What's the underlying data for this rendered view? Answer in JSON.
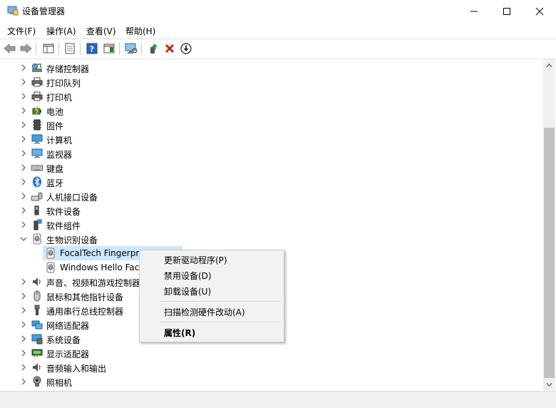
{
  "window": {
    "title": "设备管理器"
  },
  "menu": [
    {
      "id": "file",
      "label": "文件(F)"
    },
    {
      "id": "action",
      "label": "操作(A)"
    },
    {
      "id": "view",
      "label": "查看(V)"
    },
    {
      "id": "help",
      "label": "帮助(H)"
    }
  ],
  "tree": {
    "categories": [
      {
        "label": "存储控制器",
        "icon": "storage-controller-icon"
      },
      {
        "label": "打印队列",
        "icon": "print-queue-icon"
      },
      {
        "label": "打印机",
        "icon": "printer-icon"
      },
      {
        "label": "电池",
        "icon": "battery-icon"
      },
      {
        "label": "固件",
        "icon": "firmware-icon"
      },
      {
        "label": "计算机",
        "icon": "computer-icon"
      },
      {
        "label": "监视器",
        "icon": "monitor-icon"
      },
      {
        "label": "键盘",
        "icon": "keyboard-icon"
      },
      {
        "label": "蓝牙",
        "icon": "bluetooth-icon"
      },
      {
        "label": "人机接口设备",
        "icon": "hid-icon"
      },
      {
        "label": "软件设备",
        "icon": "software-device-icon"
      },
      {
        "label": "软件组件",
        "icon": "software-component-icon"
      },
      {
        "label": "生物识别设备",
        "icon": "biometric-icon",
        "expanded": true
      }
    ],
    "children": [
      {
        "label": "FocalTech Fingerpr",
        "icon": "fingerprint-icon",
        "selected": true
      },
      {
        "label": "Windows Hello Fac",
        "icon": "fingerprint-icon"
      }
    ],
    "after": [
      {
        "label": "声音、视频和游戏控制器",
        "icon": "sound-icon"
      },
      {
        "label": "鼠标和其他指针设备",
        "icon": "mouse-icon"
      },
      {
        "label": "通用串行总线控制器",
        "icon": "usb-icon"
      },
      {
        "label": "网络适配器",
        "icon": "network-adapter-icon"
      },
      {
        "label": "系统设备",
        "icon": "system-device-icon"
      },
      {
        "label": "显示适配器",
        "icon": "display-adapter-icon"
      },
      {
        "label": "音频输入和输出",
        "icon": "audio-io-icon"
      },
      {
        "label": "照相机",
        "icon": "camera-icon"
      }
    ]
  },
  "context_menu": {
    "update_driver": "更新驱动程序(P)",
    "disable_device": "禁用设备(D)",
    "uninstall_device": "卸载设备(U)",
    "scan_hardware": "扫描检测硬件改动(A)",
    "properties": "属性(R)"
  },
  "colors": {
    "selection": "#cce8ff",
    "menu_bg": "#f2f2f2",
    "uninstall_x": "#d81e06"
  }
}
